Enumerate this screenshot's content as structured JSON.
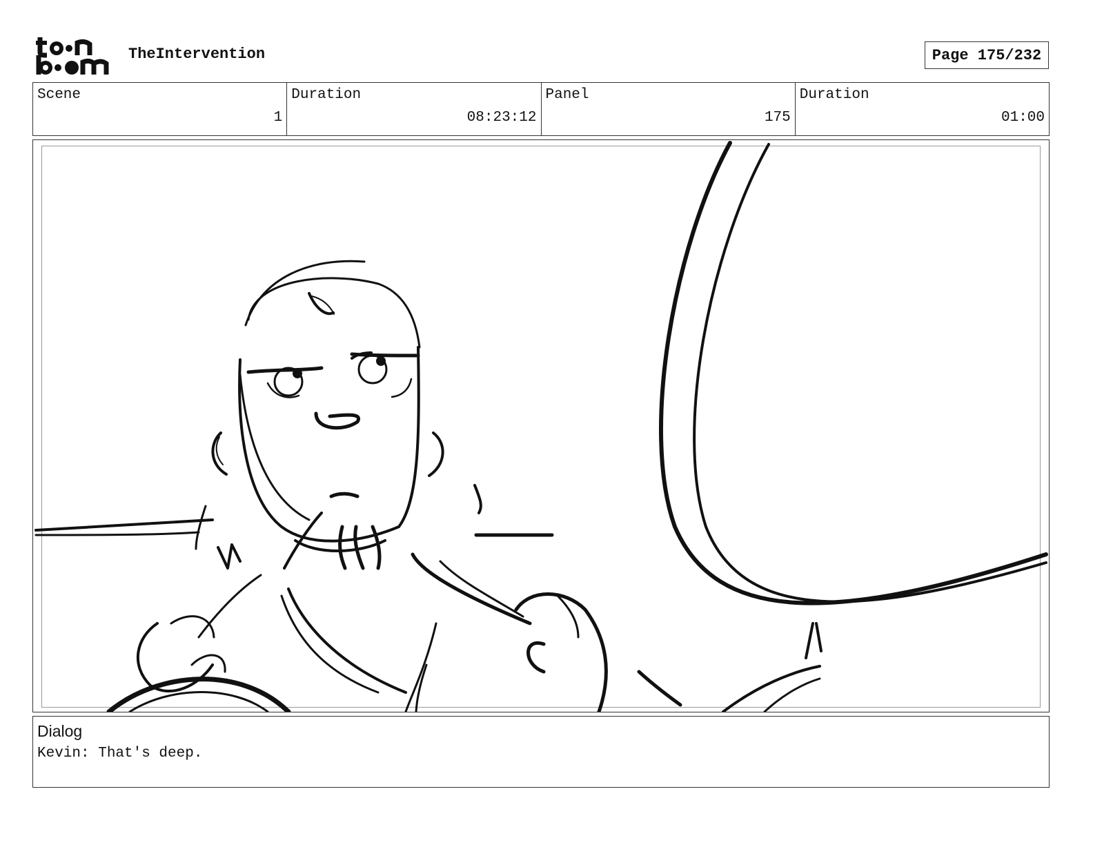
{
  "header": {
    "logo_lines": [
      "toon",
      "boom"
    ],
    "project_title": "TheIntervention",
    "page_label": "Page 175/232"
  },
  "info": {
    "scene_label": "Scene",
    "scene_value": "1",
    "scene_duration_label": "Duration",
    "scene_duration_value": "08:23:12",
    "panel_label": "Panel",
    "panel_value": "175",
    "panel_duration_label": "Duration",
    "panel_duration_value": "01:00"
  },
  "dialog": {
    "label": "Dialog",
    "text": "Kevin: That's deep."
  }
}
